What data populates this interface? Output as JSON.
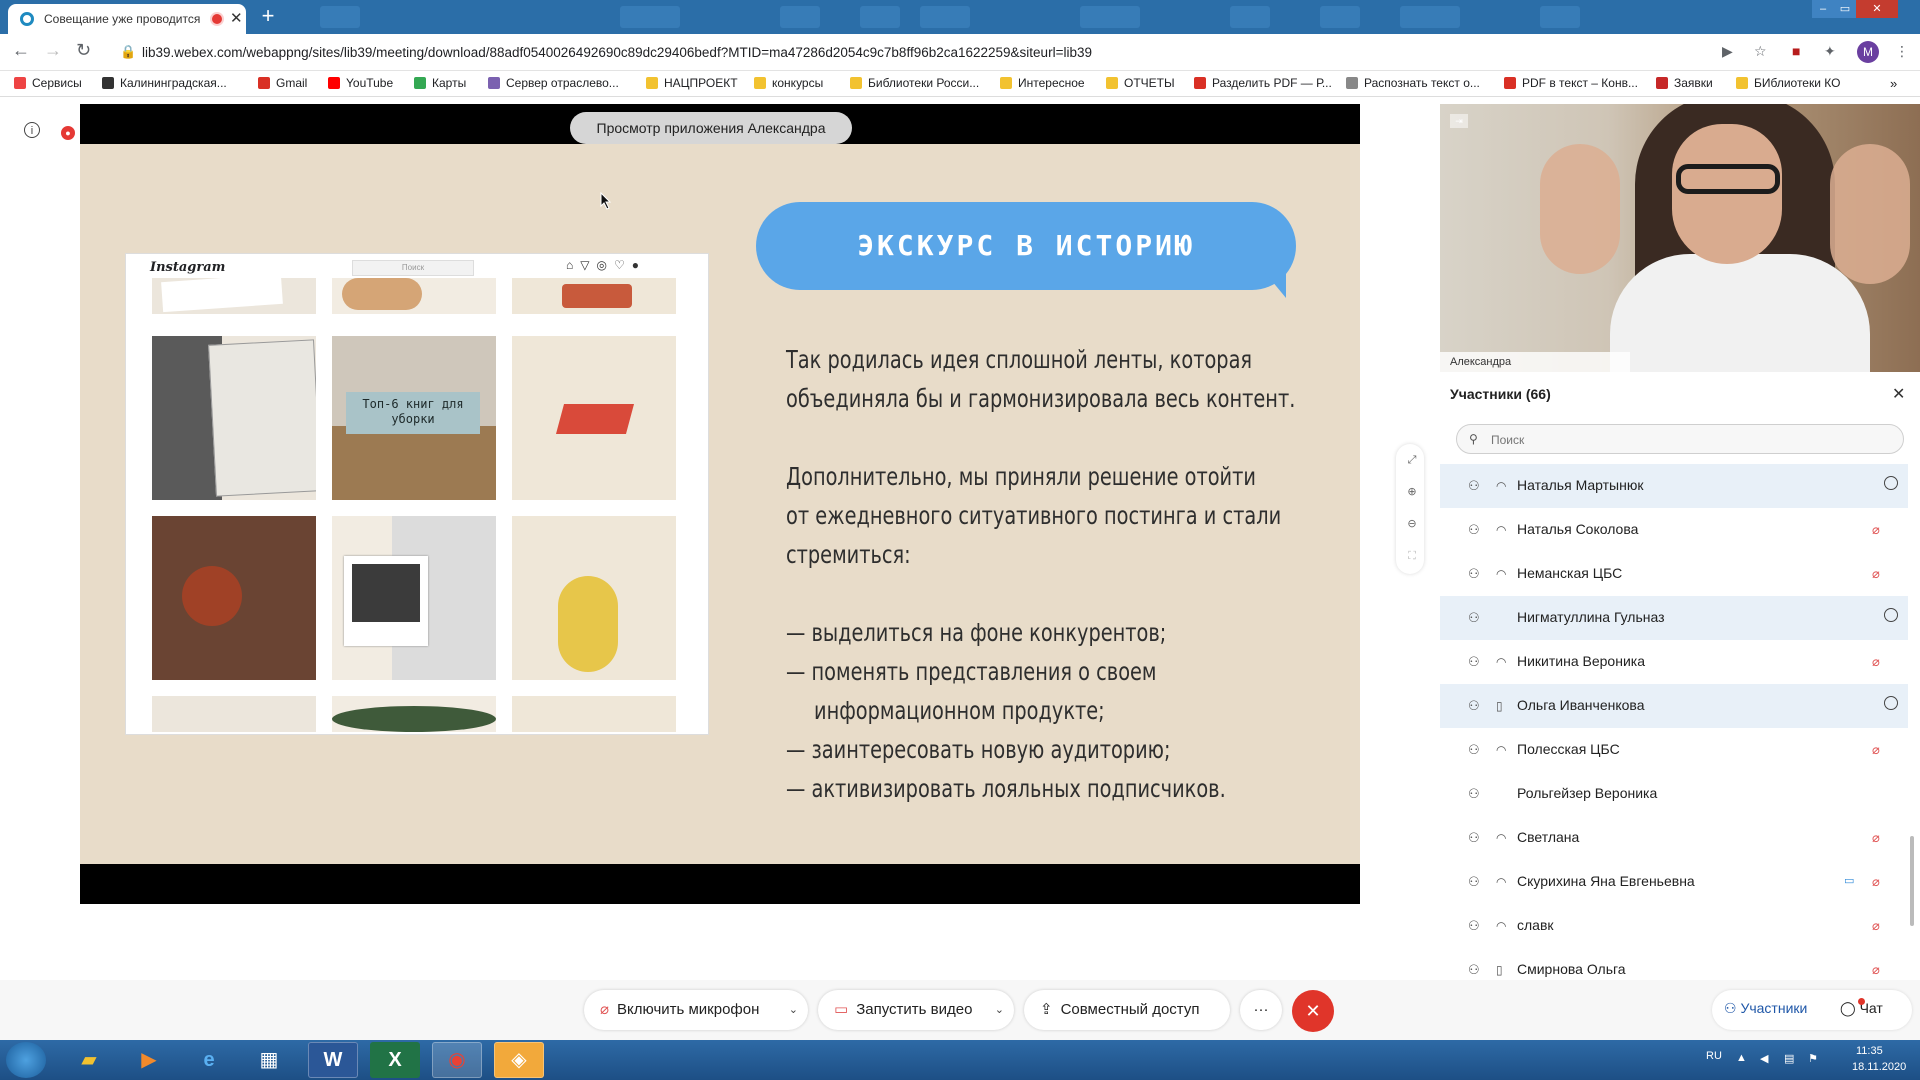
{
  "browser": {
    "tab_title": "Совещание уже проводится",
    "url": "lib39.webex.com/webappng/sites/lib39/meeting/download/88adf0540026492690c89dc29406bedf?MTID=ma47286d2054c9c7b8ff96b2ca1622259&siteurl=lib39",
    "profile_initial": "M",
    "bookmarks": [
      {
        "label": "Сервисы",
        "color": "#e44"
      },
      {
        "label": "Калининградская...",
        "color": "#333"
      },
      {
        "label": "Gmail",
        "color": "#d93025"
      },
      {
        "label": "YouTube",
        "color": "#ff0000"
      },
      {
        "label": "Карты",
        "color": "#34a853"
      },
      {
        "label": "Сервер отраслево...",
        "color": "#7b61b0"
      },
      {
        "label": "НАЦПРОЕКТ",
        "color": "#f2c230"
      },
      {
        "label": "конкурсы",
        "color": "#f2c230"
      },
      {
        "label": "Библиотеки Росси...",
        "color": "#f2c230"
      },
      {
        "label": "Интересное",
        "color": "#f2c230"
      },
      {
        "label": "ОТЧЕТЫ",
        "color": "#f2c230"
      },
      {
        "label": "Разделить PDF — Р...",
        "color": "#d93025"
      },
      {
        "label": "Распознать текст о...",
        "color": "#888"
      },
      {
        "label": "PDF в текст – Конв...",
        "color": "#d93025"
      },
      {
        "label": "Заявки",
        "color": "#c62828"
      },
      {
        "label": "БИблиотеки КО",
        "color": "#f2c230"
      }
    ]
  },
  "share": {
    "label": "Просмотр приложения Александра",
    "slide": {
      "instagram_logo": "Instagram",
      "instagram_search": "Поиск",
      "tile_caption": "Топ-6 книг для уборки",
      "heading": "ЭКСКУРС В ИСТОРИЮ",
      "lines": [
        "Так родилась идея сплошной ленты, которая",
        "объединяла бы и гармонизировала весь контент.",
        "Дополнительно, мы приняли решение отойти",
        "от ежедневного ситуативного постинга и стали",
        "стремиться:",
        "— выделиться на фоне конкурентов;",
        "— поменять представления о своем",
        "информационном продукте;",
        "— заинтересовать новую аудиторию;",
        "— активизировать лояльных подписчиков."
      ]
    }
  },
  "video": {
    "speaker_name": "Александра"
  },
  "participants": {
    "title": "Участники (66)",
    "search_placeholder": "Поиск",
    "items": [
      {
        "name": "Наталья Мартынюк",
        "audio": "headset",
        "status": "chat",
        "highlight": true
      },
      {
        "name": "Наталья Соколова",
        "audio": "headset",
        "status": "muted",
        "highlight": false
      },
      {
        "name": "Неманская ЦБС",
        "audio": "headset",
        "status": "muted",
        "highlight": false
      },
      {
        "name": "Нигматуллина Гульназ",
        "audio": "none",
        "status": "chat",
        "highlight": true
      },
      {
        "name": "Никитина Вероника",
        "audio": "headset",
        "status": "muted",
        "highlight": false
      },
      {
        "name": "Ольга Иванченкова",
        "audio": "phone",
        "status": "chat",
        "highlight": true
      },
      {
        "name": "Полесская ЦБС",
        "audio": "headset",
        "status": "muted",
        "highlight": false
      },
      {
        "name": "Рольгейзер Вероника",
        "audio": "none",
        "status": "none",
        "highlight": false
      },
      {
        "name": "Светлана",
        "audio": "headset",
        "status": "muted",
        "highlight": false
      },
      {
        "name": "Скурихина Яна Евгеньевна",
        "audio": "headset",
        "status": "muted-cam",
        "highlight": false
      },
      {
        "name": "славк",
        "audio": "headset",
        "status": "muted",
        "highlight": false
      },
      {
        "name": "Смирнова Ольга",
        "audio": "phone",
        "status": "muted",
        "highlight": false
      }
    ]
  },
  "controls": {
    "mic": "Включить микрофон",
    "video": "Запустить видео",
    "share": "Совместный доступ",
    "more": "···",
    "participants": "Участники",
    "chat": "Чат"
  },
  "taskbar": {
    "lang": "RU",
    "time": "11:35",
    "date": "18.11.2020"
  }
}
